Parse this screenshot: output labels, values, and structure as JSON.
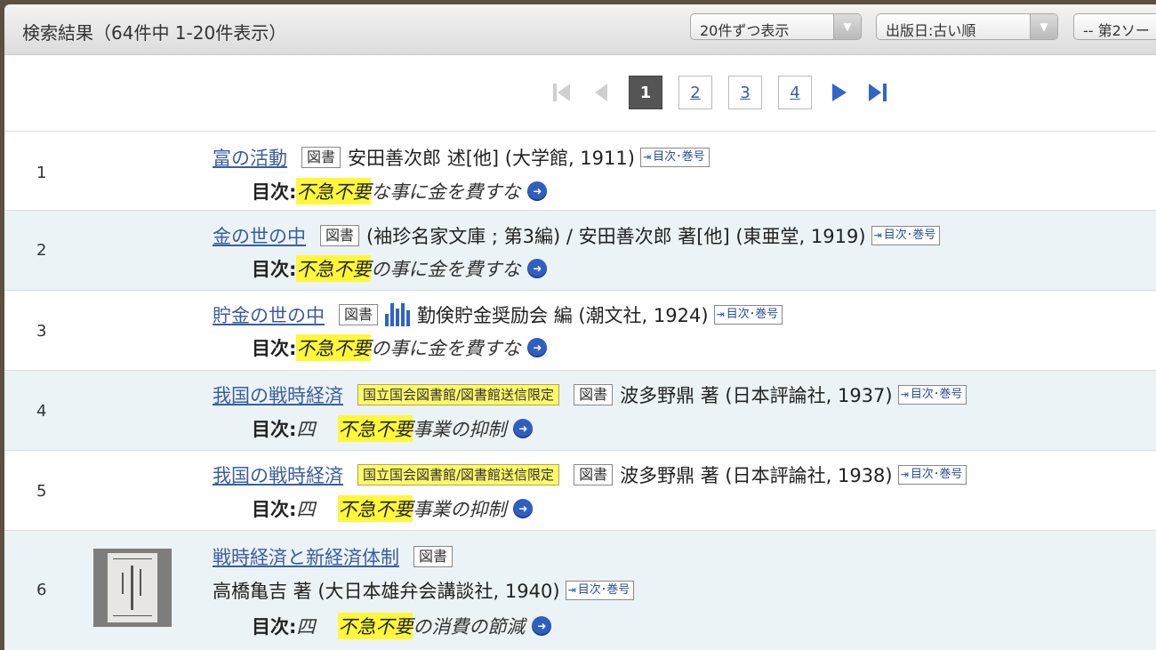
{
  "header": {
    "title": "検索結果（64件中 1-20件表示）",
    "per_page": "20件ずつ表示",
    "order": "出版日:古い順",
    "second_sort": "-- 第2ソー"
  },
  "pager": {
    "pages": [
      "1",
      "2",
      "3",
      "4"
    ],
    "current": "1"
  },
  "results": [
    {
      "num": "1",
      "title": "富の活動",
      "type": "図書",
      "meta": "安田善次郎 述[他] (大学館, 1911)",
      "toc_badge": "目次･巻号",
      "toc_label": "目次:",
      "toc_prefix": "",
      "toc_hl": "不急不要",
      "toc_rest": "な事に金を費すな"
    },
    {
      "num": "2",
      "title": "金の世の中",
      "type": "図書",
      "meta": "(袖珍名家文庫 ; 第3編) / 安田善次郎 著[他] (東亜堂, 1919)",
      "toc_badge": "目次･巻号",
      "toc_label": "目次:",
      "toc_prefix": "",
      "toc_hl": "不急不要",
      "toc_rest": "の事に金を費すな"
    },
    {
      "num": "3",
      "title": "貯金の世の中",
      "type": "図書",
      "meta": "勤倹貯金奨励会 編 (潮文社, 1924)",
      "toc_badge": "目次･巻号",
      "toc_label": "目次:",
      "toc_prefix": "",
      "toc_hl": "不急不要",
      "toc_rest": "の事に金を費すな"
    },
    {
      "num": "4",
      "title": "我国の戦時経済",
      "restriction": "国立国会図書館/図書館送信限定",
      "type": "図書",
      "meta": "波多野鼎 著 (日本評論社, 1937)",
      "toc_badge": "目次･巻号",
      "toc_label": "目次:",
      "toc_prefix": "四",
      "toc_hl": "不急不要",
      "toc_rest": "事業の抑制"
    },
    {
      "num": "5",
      "title": "我国の戦時経済",
      "restriction": "国立国会図書館/図書館送信限定",
      "type": "図書",
      "meta": "波多野鼎 著 (日本評論社, 1938)",
      "toc_badge": "目次･巻号",
      "toc_label": "目次:",
      "toc_prefix": "四",
      "toc_hl": "不急不要",
      "toc_rest": "事業の抑制"
    },
    {
      "num": "6",
      "title": "戦時経済と新経済体制",
      "type": "図書",
      "meta": "高橋亀吉 著 (大日本雄弁会講談社, 1940)",
      "toc_badge": "目次･巻号",
      "toc_label": "目次:",
      "toc_prefix": "四",
      "toc_hl": "不急不要",
      "toc_rest": "の消費の節減"
    }
  ]
}
